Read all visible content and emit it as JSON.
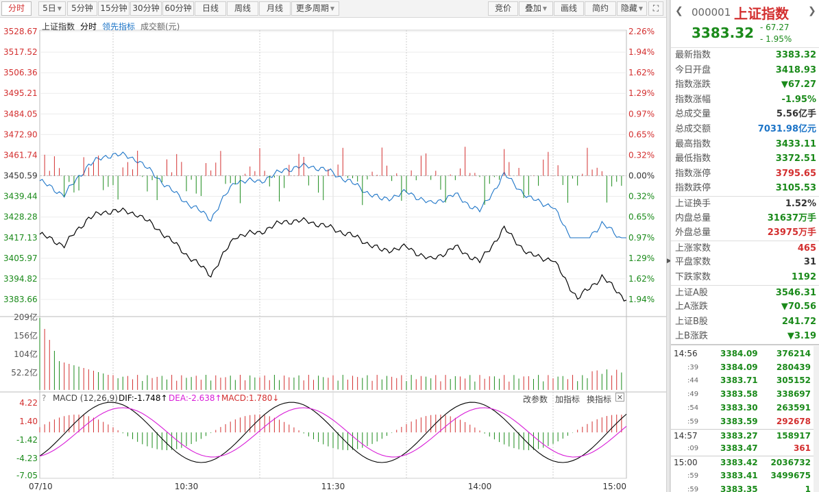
{
  "toolbar": {
    "periods": [
      "分时",
      "5日",
      "5分钟",
      "15分钟",
      "30分钟",
      "60分钟",
      "日线",
      "周线",
      "月线",
      "更多周期"
    ],
    "right_buttons": [
      "竞价",
      "叠加",
      "画线",
      "简约",
      "隐藏"
    ]
  },
  "legend": {
    "index_name": "上证指数",
    "mode": "分时",
    "lead": "领先指标",
    "amount": "成交额(元)"
  },
  "price_axis": [
    "3528.67",
    "3517.52",
    "3506.36",
    "3495.21",
    "3484.05",
    "3472.90",
    "3461.74",
    "3450.59",
    "3439.44",
    "3428.28",
    "3417.13",
    "3405.97",
    "3394.82",
    "3383.66"
  ],
  "pct_axis": [
    "2.26%",
    "1.94%",
    "1.62%",
    "1.29%",
    "0.97%",
    "0.65%",
    "0.32%",
    "0.00%",
    "0.32%",
    "0.65%",
    "0.97%",
    "1.29%",
    "1.62%",
    "1.94%"
  ],
  "vol_axis": [
    "209亿",
    "156亿",
    "104亿",
    "52.2亿"
  ],
  "macd_axis": [
    "4.22",
    "1.40",
    "-1.42",
    "-4.23",
    "-7.05"
  ],
  "time_axis": [
    "07/10",
    "10:30",
    "11:30",
    "14:00",
    "15:00"
  ],
  "macd": {
    "label": "MACD (12,26,9)",
    "dif": "DIF:-1.748↑",
    "dea": "DEA:-2.638↑",
    "macd": "MACD:1.780↓",
    "buttons": [
      "改参数",
      "加指标",
      "换指标"
    ]
  },
  "colors": {
    "up": "#d32f2f",
    "down": "#1a8a1a",
    "line": "#000000",
    "avg": "#1c74c7",
    "dif": "#000000",
    "dea": "#d81bd8"
  },
  "chart_data": {
    "type": "line",
    "title": "上证指数",
    "series": [
      {
        "name": "分时",
        "x_minutes": [
          0,
          10,
          20,
          30,
          40,
          50,
          60,
          70,
          80,
          90,
          100,
          110,
          120,
          130,
          140,
          150,
          160,
          170,
          180,
          190,
          200,
          210,
          220,
          230,
          240
        ],
        "values": [
          3418.93,
          3413,
          3428,
          3432,
          3430,
          3420,
          3408,
          3397,
          3418,
          3420,
          3426,
          3426,
          3422,
          3417,
          3410,
          3412,
          3405,
          3412,
          3404,
          3422,
          3408,
          3405,
          3384,
          3396,
          3383.32
        ]
      }
    ],
    "ylim": [
      3383.66,
      3528.67
    ]
  },
  "quote": {
    "code": "000001",
    "name": "上证指数",
    "price": "3383.32",
    "change": "- 67.27",
    "change_pct": "- 1.95%",
    "rows": [
      {
        "label": "最新指数",
        "value": "3383.32",
        "color": "#1a8a1a"
      },
      {
        "label": "今日开盘",
        "value": "3418.93",
        "color": "#1a8a1a"
      },
      {
        "label": "指数涨跌",
        "value": "▼67.27",
        "color": "#1a8a1a"
      },
      {
        "label": "指数涨幅",
        "value": "-1.95%",
        "color": "#1a8a1a"
      },
      {
        "label": "总成交量",
        "value": "5.56亿手",
        "color": "#333333"
      },
      {
        "label": "总成交额",
        "value": "7031.98亿元",
        "color": "#1c74c7"
      },
      {
        "label": "最高指数",
        "value": "3433.11",
        "color": "#1a8a1a"
      },
      {
        "label": "最低指数",
        "value": "3372.51",
        "color": "#1a8a1a"
      },
      {
        "label": "指数涨停",
        "value": "3795.65",
        "color": "#d32f2f"
      },
      {
        "label": "指数跌停",
        "value": "3105.53",
        "color": "#1a8a1a"
      }
    ],
    "rows2": [
      {
        "label": "上证换手",
        "value": "1.52%",
        "color": "#333333"
      },
      {
        "label": "内盘总量",
        "value": "31637万手",
        "color": "#1a8a1a"
      },
      {
        "label": "外盘总量",
        "value": "23975万手",
        "color": "#d32f2f"
      }
    ],
    "rows3": [
      {
        "label": "上涨家数",
        "value": "465",
        "color": "#d32f2f"
      },
      {
        "label": "平盘家数",
        "value": "31",
        "color": "#333333"
      },
      {
        "label": "下跌家数",
        "value": "1192",
        "color": "#1a8a1a"
      }
    ],
    "rows4": [
      {
        "label": "上证A股",
        "value": "3546.31",
        "color": "#1a8a1a"
      },
      {
        "label": "上A涨跌",
        "value": "▼70.56",
        "color": "#1a8a1a"
      },
      {
        "label": "上证B股",
        "value": "241.72",
        "color": "#1a8a1a"
      },
      {
        "label": "上B涨跌",
        "value": "▼3.19",
        "color": "#1a8a1a"
      }
    ]
  },
  "ticks": [
    {
      "time": "14:56",
      "sub": false,
      "price": "3384.09",
      "vol": "376214",
      "red": false
    },
    {
      "time": ":39",
      "sub": true,
      "price": "3384.09",
      "vol": "280439",
      "red": false
    },
    {
      "time": ":44",
      "sub": true,
      "price": "3383.71",
      "vol": "305152",
      "red": false
    },
    {
      "time": ":49",
      "sub": true,
      "price": "3383.58",
      "vol": "338697",
      "red": false
    },
    {
      "time": ":54",
      "sub": true,
      "price": "3383.30",
      "vol": "263591",
      "red": false
    },
    {
      "time": ":59",
      "sub": true,
      "price": "3383.59",
      "vol": "292678",
      "red": true
    },
    {
      "time": "14:57",
      "sub": false,
      "price": "3383.27",
      "vol": "158917",
      "red": false,
      "sep": true
    },
    {
      "time": ":09",
      "sub": true,
      "price": "3383.47",
      "vol": "361",
      "red": true
    },
    {
      "time": "15:00",
      "sub": false,
      "price": "3383.42",
      "vol": "2036732",
      "red": false,
      "sep": true
    },
    {
      "time": ":59",
      "sub": true,
      "price": "3383.41",
      "vol": "3499675",
      "red": false
    },
    {
      "time": ":59",
      "sub": true,
      "price": "3383.35",
      "vol": "1",
      "red": false
    }
  ]
}
